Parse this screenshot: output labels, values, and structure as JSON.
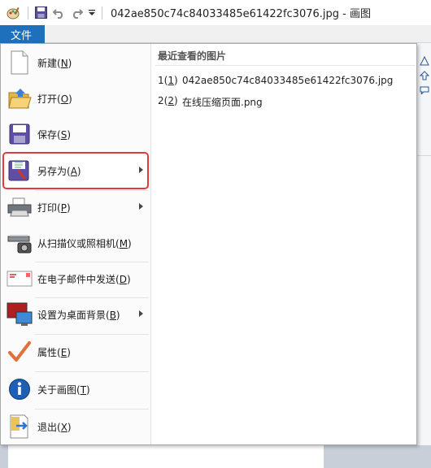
{
  "title_bar": {
    "icons": [
      "paint-app-icon",
      "save-icon",
      "undo-icon",
      "redo-icon",
      "customize-dropdown-icon"
    ],
    "title": "042ae850c74c84033485e61422fc3076.jpg - 画图"
  },
  "file_tab": {
    "label": "文件"
  },
  "menu": {
    "items": [
      {
        "text": "新建(",
        "key": "N",
        "tail": ")",
        "icon": "new-document-icon",
        "has_submenu": false
      },
      {
        "text": "打开(",
        "key": "O",
        "tail": ")",
        "icon": "open-folder-icon",
        "has_submenu": false
      },
      {
        "text": "保存(",
        "key": "S",
        "tail": ")",
        "icon": "save-disk-icon",
        "has_submenu": false
      },
      {
        "text": "另存为(",
        "key": "A",
        "tail": ")",
        "icon": "save-as-icon",
        "has_submenu": true,
        "highlighted": true
      },
      {
        "text": "打印(",
        "key": "P",
        "tail": ")",
        "icon": "printer-icon",
        "has_submenu": true
      },
      {
        "text": "从扫描仪或照相机(",
        "key": "M",
        "tail": ")",
        "icon": "scanner-camera-icon",
        "has_submenu": false
      },
      {
        "text": "在电子邮件中发送(",
        "key": "D",
        "tail": ")",
        "icon": "email-envelope-icon",
        "has_submenu": false
      },
      {
        "text": "设置为桌面背景(",
        "key": "B",
        "tail": ")",
        "icon": "desktop-background-icon",
        "has_submenu": true
      },
      {
        "text": "属性(",
        "key": "E",
        "tail": ")",
        "icon": "properties-checkmark-icon",
        "has_submenu": false
      },
      {
        "text": "关于画图(",
        "key": "T",
        "tail": ")",
        "icon": "info-icon",
        "has_submenu": false
      },
      {
        "text": "退出(",
        "key": "X",
        "tail": ")",
        "icon": "exit-icon",
        "has_submenu": false
      }
    ]
  },
  "recent": {
    "heading": "最近查看的图片",
    "items": [
      {
        "num": "1",
        "key": "1",
        "name": "042ae850c74c84033485e61422fc3076.jpg"
      },
      {
        "num": "2",
        "key": "2",
        "name": "在线压缩页面.png"
      }
    ]
  },
  "colors": {
    "file_tab": "#1e6fbc",
    "highlight_outline": "#e23b3b"
  }
}
